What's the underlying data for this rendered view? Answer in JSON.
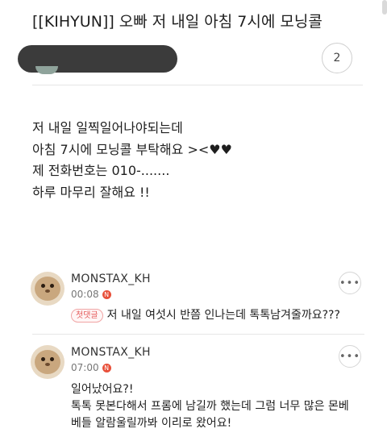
{
  "post": {
    "title": "[[KIHYUN]] 오빠 저 내일 아침 7시에 모닝콜",
    "comment_count": "2",
    "body_lines": [
      "저 내일 일찍일어나야되는데",
      "아침 7시에 모닝콜 부탁해요 ><♥♥",
      "제 전화번호는 010-.......",
      "하루 마무리 잘해요 !!"
    ]
  },
  "comments": [
    {
      "author": "MONSTAX_KH",
      "time": "00:08",
      "new_badge": "N",
      "first_badge": "첫댓글",
      "lines": [
        "저 내일 여섯시 반쯤 인나는데 톡톡남겨줄까요???"
      ]
    },
    {
      "author": "MONSTAX_KH",
      "time": "07:00",
      "new_badge": "N",
      "lines": [
        "일어났어요?!",
        "톡톡 못본다해서 프롬에 남길까 했는데 그럼 너무 많은 몬베",
        "베들 알람울릴까봐 이리로 왔어요!"
      ]
    }
  ],
  "icons": {
    "more": "more-horizontal-icon",
    "new": "new-indicator-icon"
  },
  "colors": {
    "new_badge": "#e8503a",
    "first_badge": "#e45b5b"
  }
}
